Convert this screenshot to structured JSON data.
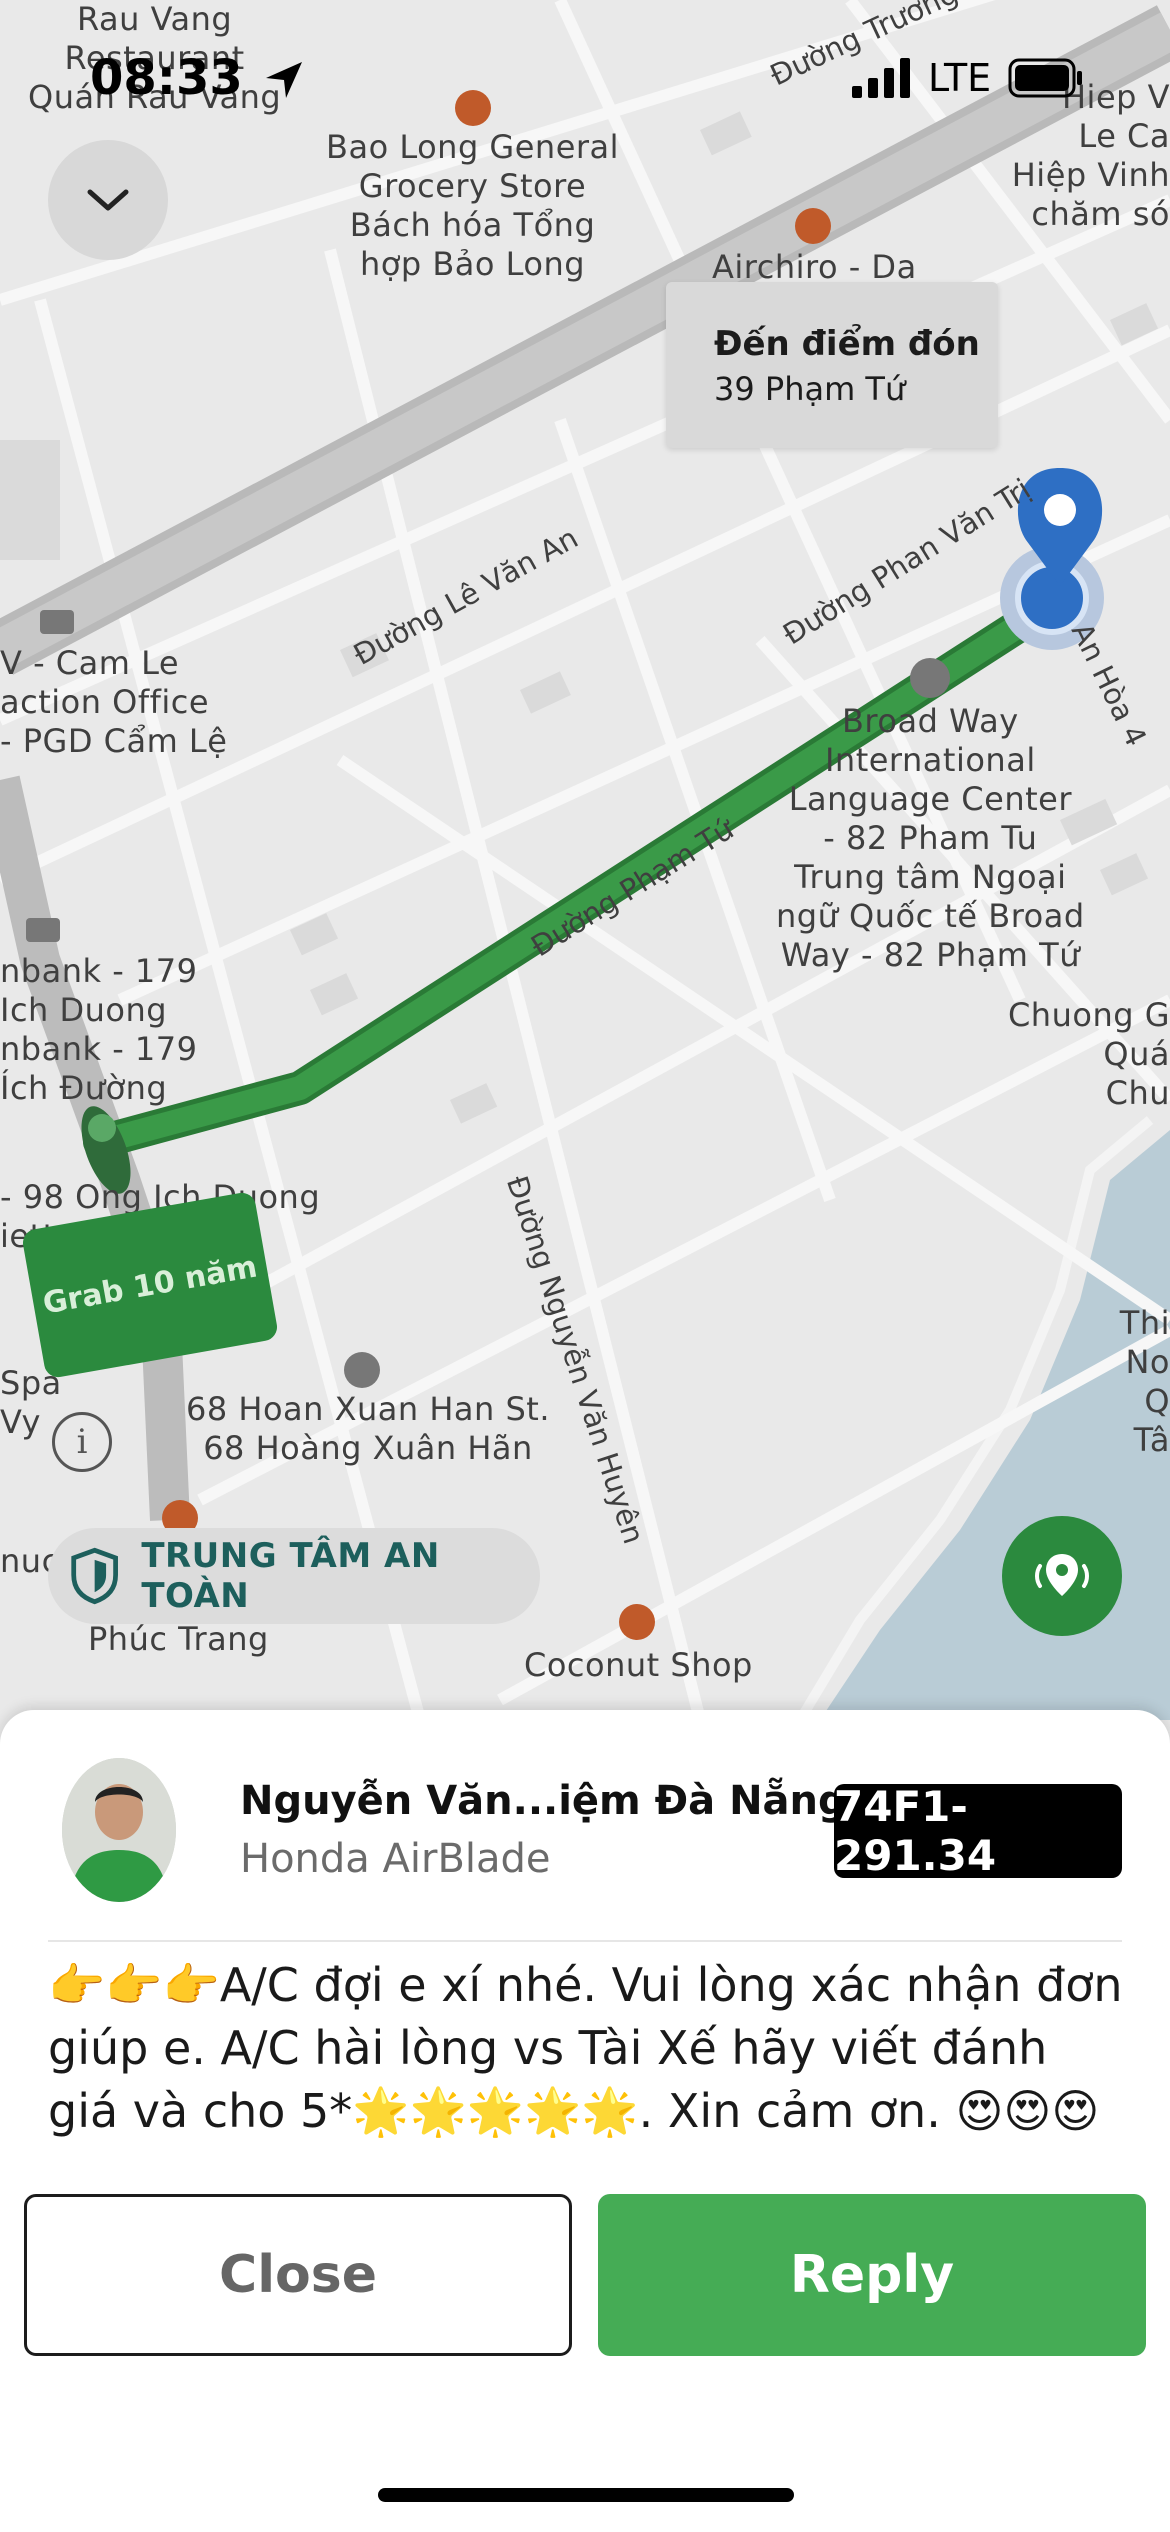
{
  "status_bar": {
    "time": "08:33",
    "network": "LTE"
  },
  "map": {
    "pickup_callout": {
      "title": "Đến điểm đón",
      "address": "39 Phạm Tứ"
    },
    "streets": [
      "Đường Trương",
      "Đường Lê Văn An",
      "Đường Phan Văn Trị",
      "Đường Phạm Tứ",
      "Đường Nguyễn Văn Huyên",
      "An Hòa 4"
    ],
    "places": {
      "rau_vang": "Rau Vang\nRestaurant\nQuán Rau Vang",
      "bao_long": "Bao Long General\nGrocery Store\nBách hóa Tổng\nhợp Bảo Long",
      "airchiro": "Airchiro - Da",
      "hiep_vinh": "Hiep V\nLe Ca\nHiệp Vinh\nchăm só",
      "cam_le": "V - Cam Le\naction Office\n- PGD Cẩm Lệ",
      "broadway": "Broad Way\nInternational\nLanguage Center\n- 82 Pham Tu\nTrung tâm Ngoại\nngữ Quốc tế Broad\nWay - 82 Phạm Tứ",
      "nbank": "nbank - 179\nIch Duong\nnbank - 179\nÍch Đường",
      "chuong": "Chuong G\nQuá\nChu",
      "ong_ich": "- 98 Ong Ich Duong\niettel -",
      "hoan_xuan": "68 Hoan Xuan Han St.\n68 Hoàng Xuân Hãn",
      "spa": "Spa\nVy",
      "thi": "Thi\nNo\nQ\nTâ",
      "nuc": "nuc",
      "phuc_trang": "Phúc Trang",
      "coconut": "Coconut Shop"
    },
    "brand_badge": "Grab 10 năm",
    "safety_center_label": "TRUNG TÂM AN TOÀN"
  },
  "driver": {
    "name": "Nguyễn Văn...iệm Đà Nẵng",
    "vehicle": "Honda AirBlade",
    "plate": "74F1-291.34"
  },
  "message": "👉👉👉A/C đợi e xí nhé. Vui lòng xác nhận đơn giúp e. A/C hài lòng vs Tài Xế hãy viết đánh giá và cho 5*🌟🌟🌟🌟🌟. Xin cảm ơn. 😍😍😍",
  "actions": {
    "close": "Close",
    "reply": "Reply"
  },
  "colors": {
    "route": "#3a9a48",
    "brand_green": "#2b8a3e",
    "button_green": "#45ac55",
    "pin_blue": "#2e6fc4"
  }
}
